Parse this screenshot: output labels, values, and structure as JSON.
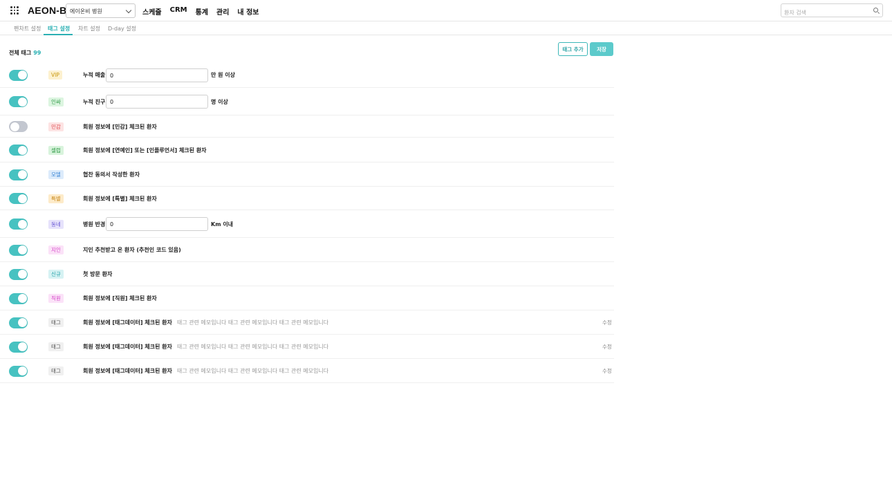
{
  "app": {
    "logo": "AEON-B",
    "grid_icon": "apps-grid-icon"
  },
  "hospital_select": {
    "value": "에이온비 병원"
  },
  "nav": [
    "스케줄",
    "CRM",
    "통계",
    "관리",
    "내 정보"
  ],
  "search": {
    "placeholder": "환자 검색"
  },
  "subtabs": [
    {
      "label": "펜차트 설정",
      "active": false
    },
    {
      "label": "태그 설정",
      "active": true
    },
    {
      "label": "차트 설정",
      "active": false
    },
    {
      "label": "D-day 설정",
      "active": false
    }
  ],
  "header": {
    "total_label": "전체 태그",
    "total_count": "99",
    "add_button": "태그 추가",
    "save_button": "저장"
  },
  "colors": {
    "accent": "#2ab0b3",
    "toggle_on": "#47c2c1",
    "toggle_off": "#c3c7d0"
  },
  "tags": [
    {
      "on": true,
      "badge": "VIP",
      "badge_color": "#c8960c",
      "badge_bg": "#fdf1cf",
      "label": "누적 매출",
      "input_value": "0",
      "unit": "만 원 이상"
    },
    {
      "on": true,
      "badge": "인싸",
      "badge_color": "#2f9a46",
      "badge_bg": "#dcf5e0",
      "label": "누적 친구",
      "input_value": "0",
      "unit": "명 이상"
    },
    {
      "on": false,
      "badge": "민감",
      "badge_color": "#e0484d",
      "badge_bg": "#fde3e3",
      "label": "회원 정보에 [민감] 체크된 환자"
    },
    {
      "on": true,
      "badge": "셀럽",
      "badge_color": "#2f9a46",
      "badge_bg": "#d8f3dc",
      "label": "회원 정보에 [연예인] 또는 [인플루언서] 체크된 환자"
    },
    {
      "on": true,
      "badge": "모델",
      "badge_color": "#3a86d6",
      "badge_bg": "#dcebfb",
      "label": "협찬 동의서 작성한 환자"
    },
    {
      "on": true,
      "badge": "특별",
      "badge_color": "#c9881a",
      "badge_bg": "#fdebc9",
      "label": "회원 정보에 [특별] 체크된 환자"
    },
    {
      "on": true,
      "badge": "동네",
      "badge_color": "#6a5ad4",
      "badge_bg": "#e6e2fb",
      "label": "병원 반경",
      "input_value": "0",
      "unit": "Km 이내"
    },
    {
      "on": true,
      "badge": "지인",
      "badge_color": "#d545c8",
      "badge_bg": "#fbe2f8",
      "label": "지인 추천받고 온 환자 (추천인 코드 있음)"
    },
    {
      "on": true,
      "badge": "신규",
      "badge_color": "#1f9fa6",
      "badge_bg": "#d6f2f3",
      "label": "첫 방문 환자"
    },
    {
      "on": true,
      "badge": "직원",
      "badge_color": "#d545c8",
      "badge_bg": "#fbe2f8",
      "label": "회원 정보에 [직원] 체크된 환자"
    },
    {
      "on": true,
      "badge": "태그",
      "badge_color": "#555555",
      "badge_bg": "#f0f0f0",
      "label": "회원 정보에 [태그데이터] 체크된 환자",
      "memo": "태그 관련 메모입니다 태그 관련 메모입니다  태그 관련 메모입니다",
      "edit": "수정"
    },
    {
      "on": true,
      "badge": "태그",
      "badge_color": "#555555",
      "badge_bg": "#f0f0f0",
      "label": "회원 정보에 [태그데이터] 체크된 환자",
      "memo": "태그 관련 메모입니다 태그 관련 메모입니다  태그 관련 메모입니다",
      "edit": "수정"
    },
    {
      "on": true,
      "badge": "태그",
      "badge_color": "#555555",
      "badge_bg": "#f0f0f0",
      "label": "회원 정보에 [태그데이터] 체크된 환자",
      "memo": "태그 관련 메모입니다 태그 관련 메모입니다  태그 관련 메모입니다",
      "edit": "수정"
    }
  ]
}
